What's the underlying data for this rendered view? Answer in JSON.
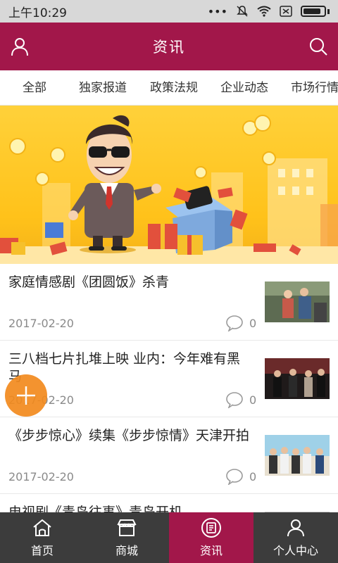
{
  "status": {
    "time": "上午10:29"
  },
  "header": {
    "title": "资讯",
    "user_icon": "user-icon",
    "search_icon": "search-icon"
  },
  "tabs": [
    {
      "label": "全部"
    },
    {
      "label": "独家报道"
    },
    {
      "label": "政策法规"
    },
    {
      "label": "企业动态"
    },
    {
      "label": "市场行情"
    }
  ],
  "news": [
    {
      "title": "家庭情感剧《团圆饭》杀青",
      "date": "2017-02-20",
      "comments": "0"
    },
    {
      "title": "三八档七片扎堆上映 业内：今年难有黑马",
      "date": "2017-02-20",
      "comments": "0"
    },
    {
      "title": "《步步惊心》续集《步步惊情》天津开拍",
      "date": "2017-02-20",
      "comments": "0"
    },
    {
      "title": "电视剧《青岛往事》青岛开机"
    }
  ],
  "bottom_nav": [
    {
      "label": "首页",
      "icon": "home-icon"
    },
    {
      "label": "商城",
      "icon": "shop-icon"
    },
    {
      "label": "资讯",
      "icon": "news-icon"
    },
    {
      "label": "个人中心",
      "icon": "profile-icon"
    }
  ],
  "colors": {
    "brand": "#a2174a",
    "nav_bg": "#3c3c3c",
    "fab": "#f28a1e"
  }
}
